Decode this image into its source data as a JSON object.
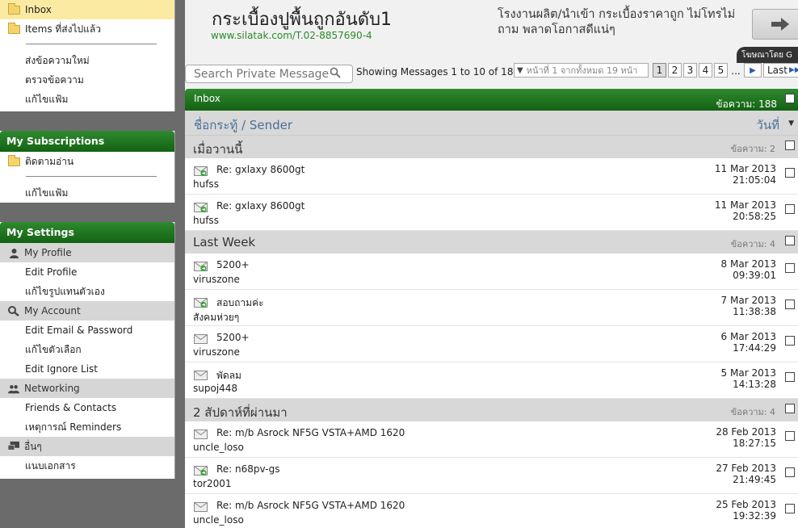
{
  "folders": {
    "items": [
      {
        "label": "Inbox",
        "active": true
      },
      {
        "label": "Items ที่ส่งไปแล้ว",
        "active": false
      }
    ],
    "links": [
      "ส่งข้อความใหม่",
      "ตรวจข้อความ",
      "แก้ไขแฟ้ม"
    ]
  },
  "subscriptions": {
    "title": "My Subscriptions",
    "folder": "ติดตามอ่าน",
    "link": "แก้ไขแฟ้ม"
  },
  "settings": {
    "title": "My Settings",
    "sections": [
      {
        "label": "My Profile",
        "icon": "user-icon",
        "links": [
          "Edit Profile",
          "แก้ไขรูปแทนตัวเอง"
        ]
      },
      {
        "label": "My Account",
        "icon": "key-icon",
        "links": [
          "Edit Email & Password",
          "แก้ไขตัวเลือก",
          "Edit Ignore List"
        ]
      },
      {
        "label": "Networking",
        "icon": "people-icon",
        "links": [
          "Friends & Contacts",
          "เหตุการณ์ Reminders"
        ]
      },
      {
        "label": "อื่นๆ",
        "icon": "computer-icon",
        "links": [
          "แนบเอกสาร"
        ]
      }
    ]
  },
  "ad": {
    "title": "กระเบื้องปูพื้นถูกอันดับ1",
    "url": "www.silatak.com/T.02-8857690-4",
    "desc": "โรงงานผลิต/นำเข้า กระเบื้องราคาถูก ไม่โทรไม่ถาม พลาดโอกาสดีแน่ๆ",
    "tag": "โฆษณาโดย G"
  },
  "toolbar": {
    "search_placeholder": "Search Private Messages",
    "showing": "Showing Messages 1 to 10 of 188",
    "page_select": "หน้าที่ 1 จากทั้งหมด 19 หน้า",
    "pages": [
      "1",
      "2",
      "3",
      "4",
      "5"
    ],
    "dots": "...",
    "last": "Last"
  },
  "list": {
    "folder": "Inbox",
    "count_label": "ข้อความ: 188",
    "col_title": "ชื่อกระทู้ / Sender",
    "col_date": "วันที่",
    "groups": [
      {
        "label": "เมื่อวานนี้",
        "count": "ข้อความ: 2",
        "messages": [
          {
            "subject": "Re: gxlaxy 8600gt",
            "sender": "hufss",
            "date": "11 Mar 2013",
            "time": "21:05:04",
            "replied": true
          },
          {
            "subject": "Re: gxlaxy 8600gt",
            "sender": "hufss",
            "date": "11 Mar 2013",
            "time": "20:58:25",
            "replied": true
          }
        ]
      },
      {
        "label": "Last Week",
        "count": "ข้อความ: 4",
        "messages": [
          {
            "subject": "5200+",
            "sender": "viruszone",
            "date": "8 Mar 2013",
            "time": "09:39:01",
            "replied": true
          },
          {
            "subject": "สอบถามค่ะ",
            "sender": "สังคมห่วยๆ",
            "date": "7 Mar 2013",
            "time": "11:38:38",
            "replied": true
          },
          {
            "subject": "5200+",
            "sender": "viruszone",
            "date": "6 Mar 2013",
            "time": "17:44:29",
            "replied": false
          },
          {
            "subject": "พัดลม",
            "sender": "supoj448",
            "date": "5 Mar 2013",
            "time": "14:13:28",
            "replied": false
          }
        ]
      },
      {
        "label": "2 สัปดาห์ที่ผ่านมา",
        "count": "ข้อความ: 4",
        "messages": [
          {
            "subject": "Re: m/b Asrock NF5G VSTA+AMD 1620",
            "sender": "uncle_loso",
            "date": "28 Feb 2013",
            "time": "18:27:15",
            "replied": false
          },
          {
            "subject": "Re: n68pv-gs",
            "sender": "tor2001",
            "date": "27 Feb 2013",
            "time": "21:49:45",
            "replied": true
          },
          {
            "subject": "Re: m/b Asrock NF5G VSTA+AMD 1620",
            "sender": "uncle_loso",
            "date": "25 Feb 2013",
            "time": "19:32:39",
            "replied": false
          }
        ]
      }
    ]
  }
}
